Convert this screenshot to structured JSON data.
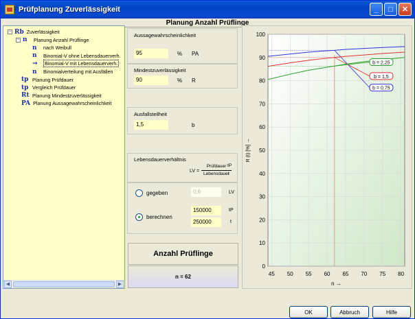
{
  "window": {
    "title": "Prüfplanung Zuverlässigkeit",
    "header": "Planung Anzahl Prüflinge"
  },
  "tree": [
    {
      "icon": "Rb",
      "label": "Zuverlässigkeit",
      "indent": 0,
      "expander": "−",
      "icon_name": "rb-icon"
    },
    {
      "icon": "n",
      "label": "Planung Anzahl Prüflinge",
      "indent": 1,
      "expander": "−",
      "icon_name": "n-icon"
    },
    {
      "icon": "n",
      "label": "nach Weibull",
      "indent": 2,
      "expander": "",
      "icon_name": "n-icon"
    },
    {
      "icon": "n",
      "label": "Binomial-V ohne Lebensdauerverh.",
      "indent": 2,
      "expander": "",
      "icon_name": "n-icon"
    },
    {
      "icon": "→",
      "label": "Binomial-V mit Lebensdauerverh.",
      "indent": 2,
      "expander": "",
      "icon_name": "arrow-right-icon",
      "selected": true
    },
    {
      "icon": "n",
      "label": "Binomialverteilung mit Ausfällen",
      "indent": 2,
      "expander": "",
      "icon_name": "n-icon"
    },
    {
      "icon": "tp",
      "label": "Planung Prüfdauer",
      "indent": 1,
      "expander": "",
      "icon_name": "tp-icon"
    },
    {
      "icon": "tp",
      "label": "Vergleich Prüfdauer",
      "indent": 1,
      "expander": "",
      "icon_name": "tp-icon"
    },
    {
      "icon": "Rt",
      "label": "Planung Mindestzuverlässigkeit",
      "indent": 1,
      "expander": "",
      "icon_name": "rt-icon"
    },
    {
      "icon": "PA",
      "label": "Planung Aussagewahrscheinlichkeit",
      "indent": 1,
      "expander": "",
      "icon_name": "pa-icon"
    }
  ],
  "form": {
    "aussage_label": "Aussagewahrscheinlichkeit",
    "aussage_value": "95",
    "aussage_unit": "%",
    "aussage_sym": "PA",
    "mindest_label": "Mindestzuverlässigkeit",
    "mindest_value": "90",
    "mindest_unit": "%",
    "mindest_sym": "R",
    "ausfall_label": "Ausfallsteilheit",
    "ausfall_value": "1,5",
    "ausfall_sym": "b",
    "lv_label": "Lebensdauerverhältnis",
    "lv_formula_left": "LV =",
    "lv_num": "Prüfdauer",
    "lv_den": "Lebensdauer",
    "lv_eq": "=",
    "lv_rnum": "tP",
    "lv_rden": "t",
    "gegeben_label": "gegeben",
    "gegeben_value": "0,6",
    "gegeben_sym": "LV",
    "berechnen_label": "berechnen",
    "tp_value": "150000",
    "tp_sym": "tP",
    "t_value": "250000",
    "t_sym": "t"
  },
  "result": {
    "title": "Anzahl Prüflinge",
    "value": "n = 62"
  },
  "buttons": {
    "ok": "OK",
    "abbruch": "Abbruch",
    "hilfe": "Hilfe"
  },
  "chart_data": {
    "type": "line",
    "title": "",
    "xlabel": "n →",
    "ylabel": "R (t) [%] →",
    "xlim": [
      44,
      81
    ],
    "ylim": [
      0,
      100
    ],
    "xticks": [
      45,
      50,
      55,
      60,
      65,
      70,
      75,
      80
    ],
    "yticks": [
      0,
      10,
      20,
      30,
      40,
      50,
      60,
      70,
      80,
      90,
      100
    ],
    "series": [
      {
        "name": "b = 0,75",
        "color": "#3030e0",
        "x": [
          44,
          50,
          55,
          60,
          62,
          65,
          70,
          75,
          81
        ],
        "y": [
          90.5,
          91.5,
          92.3,
          92.9,
          93.1,
          93.5,
          93.9,
          94.3,
          94.7
        ]
      },
      {
        "name": "b = 1,5",
        "color": "#e03030",
        "x": [
          44,
          50,
          55,
          60,
          62,
          65,
          70,
          75,
          81
        ],
        "y": [
          86.2,
          87.7,
          88.8,
          89.7,
          90.0,
          90.5,
          91.1,
          91.7,
          92.3
        ]
      },
      {
        "name": "b = 2,25",
        "color": "#30a030",
        "x": [
          44,
          50,
          55,
          60,
          62,
          65,
          70,
          75,
          81
        ],
        "y": [
          80.5,
          82.8,
          84.5,
          85.8,
          86.3,
          87.1,
          88.2,
          89.1,
          90.0
        ]
      }
    ],
    "marker": {
      "x": 62,
      "color": "#e08080"
    },
    "grid": true
  },
  "colors": {
    "tree_bg": "#ffffc8",
    "field_bg": "#ffffc8",
    "titlebar": "#0a5ad6"
  }
}
